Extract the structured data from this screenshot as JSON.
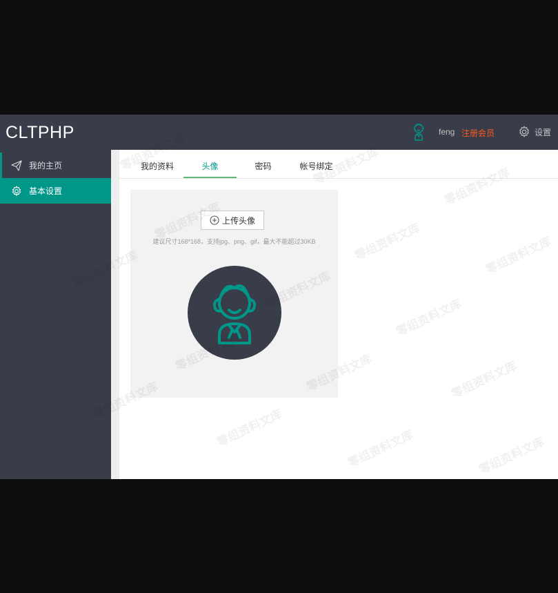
{
  "header": {
    "logo": "CLTPHP",
    "user_name": "feng",
    "register_label": "注册会员",
    "settings_label": "设置"
  },
  "sidebar": {
    "items": [
      {
        "label": "我的主页",
        "icon": "paper-plane-icon"
      },
      {
        "label": "基本设置",
        "icon": "gear-icon"
      }
    ]
  },
  "tabs": [
    {
      "label": "我的资料"
    },
    {
      "label": "头像"
    },
    {
      "label": "密码"
    },
    {
      "label": "帐号绑定"
    }
  ],
  "avatar_panel": {
    "upload_label": "上传头像",
    "hint": "建议尺寸168*168，支持jpg、png、gif，最大不能超过30KB"
  },
  "watermark": "零组资料文库",
  "colors": {
    "topbar": "#393d49",
    "accent": "#009688",
    "register": "#ff5722"
  }
}
